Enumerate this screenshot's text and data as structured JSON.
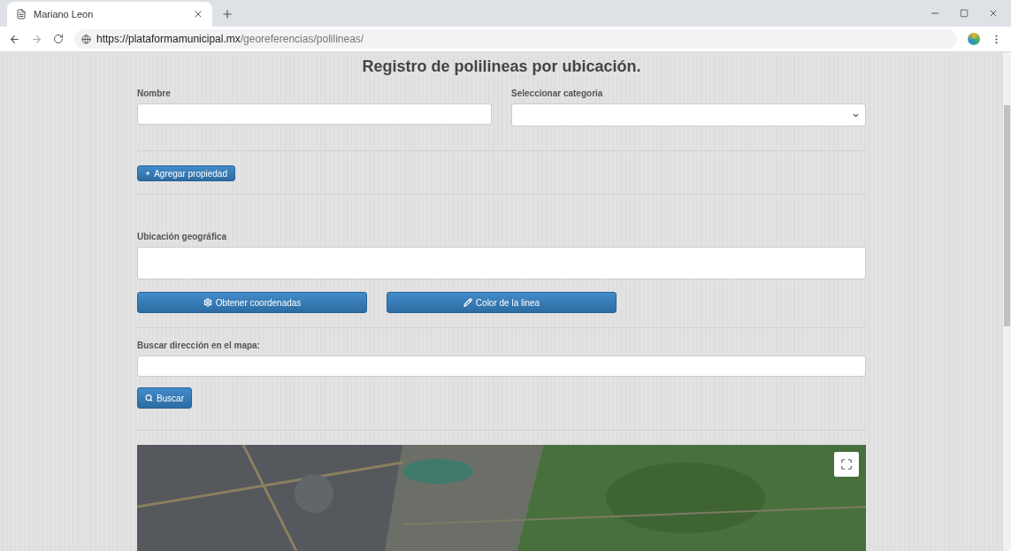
{
  "browser": {
    "tab_title": "Mariano Leon",
    "url_host": "https://plataformamunicipal.mx",
    "url_path": "/georeferencias/polilineas/"
  },
  "title": "Registro de polilineas por ubicación.",
  "name_field": {
    "label": "Nombre"
  },
  "category_select": {
    "label": "Seleccionar categoria"
  },
  "add_property_button": "Agregar propiedad",
  "location_field": {
    "label": "Ubicación geográfica"
  },
  "coords_button": "Obtener coordenadas",
  "color_button": "Color de la linea",
  "address_field": {
    "label": "Buscar dirección en el mapa:"
  },
  "search_button": "Buscar"
}
